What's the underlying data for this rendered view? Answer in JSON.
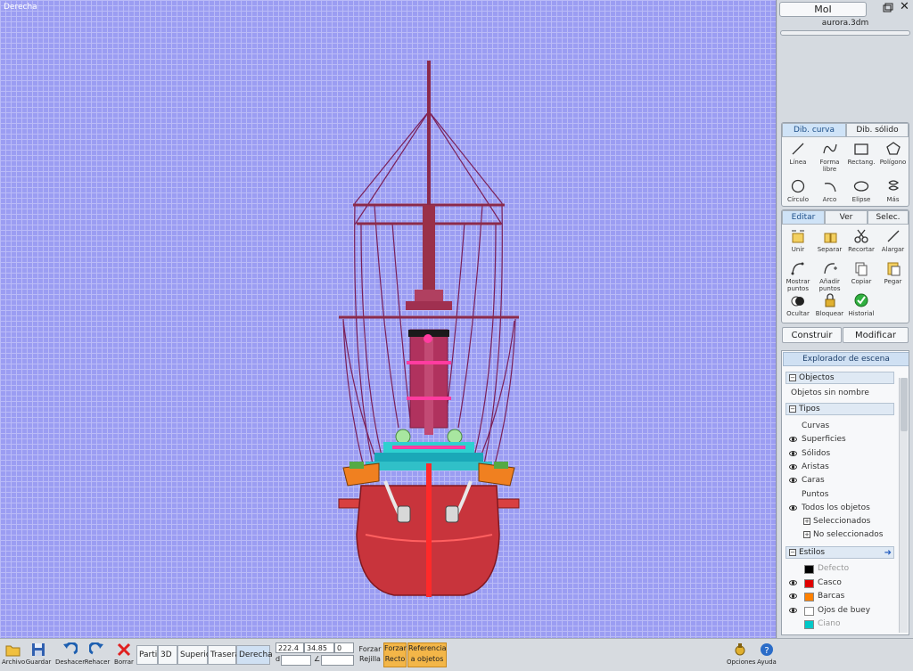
{
  "viewport": {
    "label": "Derecha"
  },
  "app": {
    "title": "MoI",
    "filename": "aurora.3dm"
  },
  "draw_tabs": {
    "curve": "Dib. curva",
    "solid": "Dib. sólido"
  },
  "draw_tools": [
    {
      "label": "Línea",
      "icon": "line-icon"
    },
    {
      "label": "Forma libre",
      "icon": "freeform-icon"
    },
    {
      "label": "Rectang.",
      "icon": "rectangle-icon"
    },
    {
      "label": "Polígono",
      "icon": "polygon-icon"
    },
    {
      "label": "Círculo",
      "icon": "circle-icon"
    },
    {
      "label": "Arco",
      "icon": "arc-icon"
    },
    {
      "label": "Elipse",
      "icon": "ellipse-icon"
    },
    {
      "label": "Más",
      "icon": "more-icon"
    }
  ],
  "edit_tabs": {
    "edit": "Editar",
    "view": "Ver",
    "select": "Selec."
  },
  "edit_tools": [
    {
      "label": "Unir",
      "icon": "join-icon"
    },
    {
      "label": "Separar",
      "icon": "separate-icon"
    },
    {
      "label": "Recortar",
      "icon": "trim-icon"
    },
    {
      "label": "Alargar",
      "icon": "extend-icon"
    },
    {
      "label": "Mostrar puntos",
      "icon": "show-points-icon"
    },
    {
      "label": "Añadir puntos",
      "icon": "add-points-icon"
    },
    {
      "label": "Copiar",
      "icon": "copy-icon"
    },
    {
      "label": "Pegar",
      "icon": "paste-icon"
    },
    {
      "label": "Ocultar",
      "icon": "hide-icon"
    },
    {
      "label": "Bloquear",
      "icon": "lock-icon"
    },
    {
      "label": "Historial",
      "icon": "history-icon"
    }
  ],
  "construct": {
    "build": "Construir",
    "modify": "Modificar"
  },
  "explorer": {
    "title": "Explorador de escena",
    "objects_section": "Objectos",
    "unnamed": "Objetos sin nombre",
    "types_section": "Tipos",
    "types": [
      "Curvas",
      "Superficies",
      "Sólidos",
      "Aristas",
      "Caras",
      "Puntos",
      "Todos los objetos"
    ],
    "selected": "Seleccionados",
    "unselected": "No seleccionados",
    "styles_section": "Estilos",
    "styles": [
      {
        "name": "Defecto",
        "color": "#000000"
      },
      {
        "name": "Casco",
        "color": "#e00000"
      },
      {
        "name": "Barcas",
        "color": "#ff8000"
      },
      {
        "name": "Ojos de buey",
        "color": "#ffffff"
      },
      {
        "name": "Ciano",
        "color": "#00c8c8"
      }
    ]
  },
  "bottom": {
    "file": "Archivo",
    "save": "Guardar",
    "undo": "Deshacer",
    "redo": "Rehacer",
    "delete": "Borrar",
    "views": [
      "Partir",
      "3D",
      "Superior",
      "Trasera",
      "Derecha"
    ],
    "coord_x": "222.4",
    "coord_y": "34.85",
    "coord_z": "0",
    "dist_label": "d",
    "angle_label": "∠",
    "snap_grid": [
      "Forzar",
      "Rejilla"
    ],
    "snap_straight": [
      "Forzar",
      "Recto"
    ],
    "obj_ref": [
      "Referencia",
      "a objetos"
    ],
    "options": "Opciones",
    "help": "Ayuda"
  },
  "colors": {
    "viewport_bg": "#9b9df2",
    "hull": "#c8343c",
    "mast": "#8b2a4a",
    "accent": "#cfe3f7"
  }
}
